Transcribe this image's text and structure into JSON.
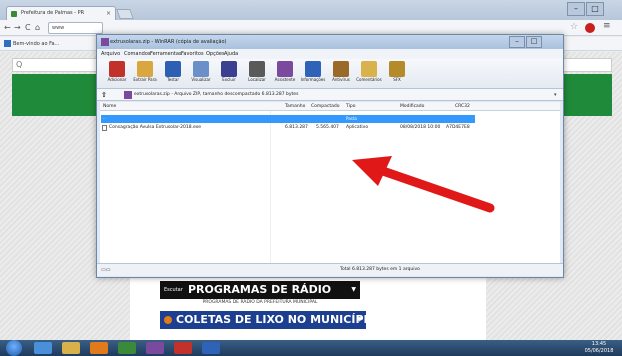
{
  "browser": {
    "tab_title": "Prefeitura de Palmas - PR",
    "tab_close": "×",
    "omnibox_text": "www",
    "bookmark_label": "Bem-vindo ao Fa...",
    "search_glyph": "Q",
    "window_controls": [
      "–",
      "□",
      "×"
    ],
    "nav_back": "←",
    "nav_forward": "→",
    "nav_reload": "C",
    "nav_home": "⌂"
  },
  "winrar": {
    "title": "extrusolaras.zip - WinRAR (cópia de avaliação)",
    "controls": [
      "–",
      "□",
      "×"
    ],
    "menu": [
      "Arquivo",
      "Comandos",
      "Ferramentas",
      "Favoritos",
      "Opções",
      "Ajuda"
    ],
    "toolbar": [
      {
        "label": "Adicionar",
        "icon": "add-icon",
        "color": "#c2322a"
      },
      {
        "label": "Extrair Para",
        "icon": "extract-icon",
        "color": "#d9a640"
      },
      {
        "label": "Testar",
        "icon": "test-icon",
        "color": "#2d5fb3"
      },
      {
        "label": "Visualizar",
        "icon": "view-icon",
        "color": "#6b8fc8"
      },
      {
        "label": "Excluir",
        "icon": "delete-icon",
        "color": "#3a3f8f"
      },
      {
        "label": "Localizar",
        "icon": "find-icon",
        "color": "#5a5a5a"
      },
      {
        "label": "Assistente",
        "icon": "wizard-icon",
        "color": "#7b4a9e"
      },
      {
        "label": "Informações",
        "icon": "info-icon",
        "color": "#2e63b8"
      },
      {
        "label": "Antivírus",
        "icon": "antivirus-icon",
        "color": "#9a6a2a"
      },
      {
        "label": "Comentários",
        "icon": "comment-icon",
        "color": "#d8b24a"
      },
      {
        "label": "SFX",
        "icon": "sfx-icon",
        "color": "#b58a2a"
      }
    ],
    "path_text": "extrusolaras.zip - Arquivo ZIP, tamanho descompactado 6.813.287 bytes",
    "columns": [
      "Nome",
      "Tamanho",
      "Compactado",
      "Tipo",
      "Modificado",
      "CRC32"
    ],
    "rows": [
      {
        "name": "..",
        "size": "",
        "packed": "",
        "type": "Pasta",
        "modified": "",
        "crc": ""
      },
      {
        "name": "Consagração Avulsa Extrusolar-2018.exe",
        "size": "6.813.287",
        "packed": "5.565.407",
        "type": "Aplicativo",
        "modified": "08/08/2018 10:00",
        "crc": "A7D4E7E8"
      }
    ],
    "status_icons": "▭▭",
    "status_text": "Total 6.813.287 bytes em 1 arquivo"
  },
  "page": {
    "banner1_small": "Escutar",
    "banner1_title": "PROGRAMAS DE RÁDIO",
    "banner1_sub": "PROGRAMAS DE RÁDIO DA PREFEITURA MUNICIPAL",
    "banner2_title": "COLETAS DE LIXO NO MUNICÍPIO",
    "banner_arrow": "▼"
  },
  "taskbar": {
    "clock_time": "13:45",
    "clock_date": "05/06/2018",
    "apps": [
      {
        "icon": "ie-icon",
        "color": "#4a90d9"
      },
      {
        "icon": "folder-icon",
        "color": "#d9b04a"
      },
      {
        "icon": "media-icon",
        "color": "#e07a1a"
      },
      {
        "icon": "chrome-icon",
        "color": "#3a8a3a"
      },
      {
        "icon": "winrar-icon",
        "color": "#7b4a9e"
      },
      {
        "icon": "pdf-icon",
        "color": "#c2322a"
      },
      {
        "icon": "word-icon",
        "color": "#2e63b8"
      }
    ]
  }
}
